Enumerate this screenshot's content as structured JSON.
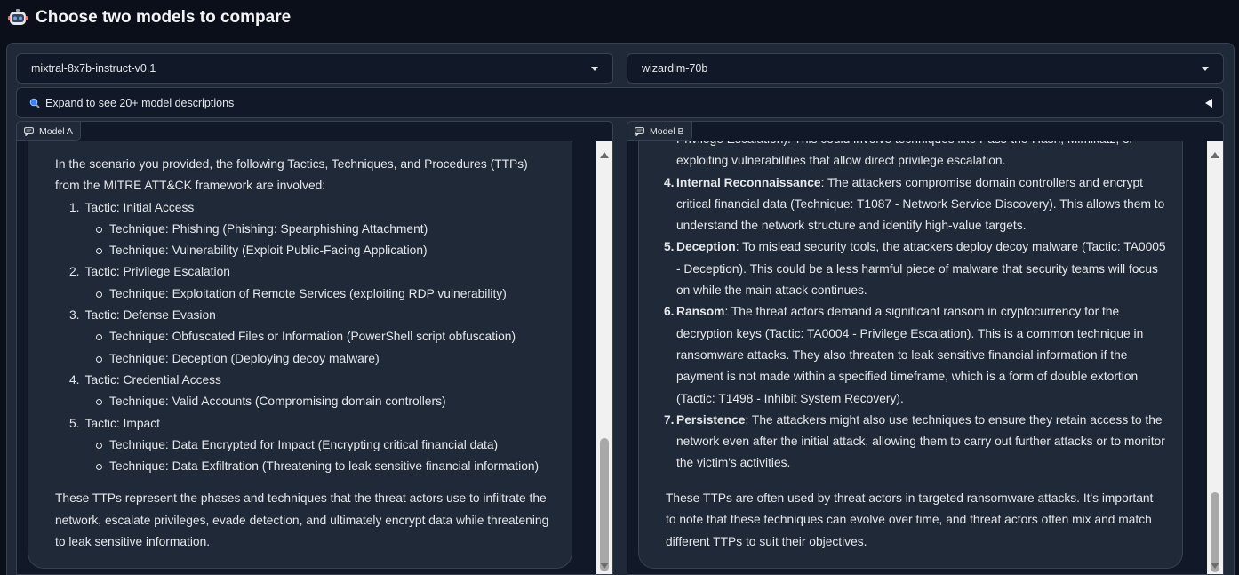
{
  "header": {
    "title": "Choose two models to compare",
    "icon": "robot-icon"
  },
  "model_a": {
    "selected": "mixtral-8x7b-instruct-v0.1",
    "tag": "Model A"
  },
  "model_b": {
    "selected": "wizardlm-70b",
    "tag": "Model B"
  },
  "accordion": {
    "label": "Expand to see 20+ model descriptions",
    "icon": "magnifier-icon"
  },
  "response_a": {
    "intro": "In the scenario you provided, the following Tactics, Techniques, and Procedures (TTPs) from the MITRE ATT&CK framework are involved:",
    "tactics": [
      {
        "num": "1.",
        "label": "Tactic: Initial Access",
        "techniques": [
          "Technique: Phishing (Phishing: Spearphishing Attachment)",
          "Technique: Vulnerability (Exploit Public-Facing Application)"
        ]
      },
      {
        "num": "2.",
        "label": "Tactic: Privilege Escalation",
        "techniques": [
          "Technique: Exploitation of Remote Services (exploiting RDP vulnerability)"
        ]
      },
      {
        "num": "3.",
        "label": "Tactic: Defense Evasion",
        "techniques": [
          "Technique: Obfuscated Files or Information (PowerShell script obfuscation)",
          "Technique: Deception (Deploying decoy malware)"
        ]
      },
      {
        "num": "4.",
        "label": "Tactic: Credential Access",
        "techniques": [
          "Technique: Valid Accounts (Compromising domain controllers)"
        ]
      },
      {
        "num": "5.",
        "label": "Tactic: Impact",
        "techniques": [
          "Technique: Data Encrypted for Impact (Encrypting critical financial data)",
          "Technique: Data Exfiltration (Threatening to leak sensitive financial information)"
        ]
      }
    ],
    "conclusion": "These TTPs represent the phases and techniques that the threat actors use to infiltrate the network, escalate privileges, evade detection, and ultimately encrypt data while threatening to leak sensitive information."
  },
  "response_b": {
    "clipped_top": "Privilege Escalation). This could involve techniques like Pass-the-Hash, Mimikatz, or",
    "continuation": "exploiting vulnerabilities that allow direct privilege escalation.",
    "items": [
      {
        "num": "4.",
        "term": "Internal Reconnaissance",
        "text": ": The attackers compromise domain controllers and encrypt critical financial data (Technique: T1087 - Network Service Discovery). This allows them to understand the network structure and identify high-value targets."
      },
      {
        "num": "5.",
        "term": "Deception",
        "text": ": To mislead security tools, the attackers deploy decoy malware (Tactic: TA0005 - Deception). This could be a less harmful piece of malware that security teams will focus on while the main attack continues."
      },
      {
        "num": "6.",
        "term": "Ransom",
        "text": ": The threat actors demand a significant ransom in cryptocurrency for the decryption keys (Tactic: TA0004 - Privilege Escalation). This is a common technique in ransomware attacks. They also threaten to leak sensitive financial information if the payment is not made within a specified timeframe, which is a form of double extortion (Tactic: T1498 - Inhibit System Recovery)."
      },
      {
        "num": "7.",
        "term": "Persistence",
        "text": ": The attackers might also use techniques to ensure they retain access to the network even after the initial attack, allowing them to carry out further attacks or to monitor the victim's activities."
      }
    ],
    "conclusion": "These TTPs are often used by threat actors in targeted ransomware attacks. It's important to note that these techniques can evolve over time, and threat actors often mix and match different TTPs to suit their objectives."
  }
}
